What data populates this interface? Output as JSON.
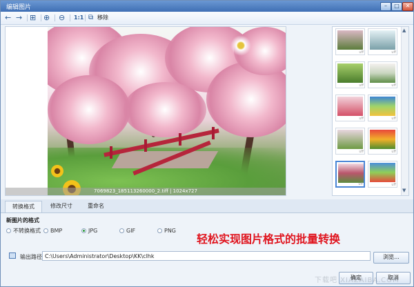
{
  "window": {
    "title": "编辑图片",
    "min_glyph": "–",
    "max_glyph": "□",
    "close_glyph": "✕"
  },
  "toolbar": {
    "back_glyph": "←",
    "forward_glyph": "→",
    "fit_glyph": "⊞",
    "zoom_in_glyph": "⊕",
    "zoom_out_glyph": "⊖",
    "actual_size_glyph": "1:1",
    "move_glyph": "⧉",
    "move_label": "移除"
  },
  "preview": {
    "filename": "7069823_185113260000_2.tiff | 1024x727"
  },
  "thumb_caption": "uff",
  "tabs": [
    {
      "label": "转换格式"
    },
    {
      "label": "修改尺寸"
    },
    {
      "label": "重命名"
    }
  ],
  "format": {
    "section_title": "新图片的格式",
    "options": [
      {
        "label": "不转换格式"
      },
      {
        "label": "BMP"
      },
      {
        "label": "JPG"
      },
      {
        "label": "GIF"
      },
      {
        "label": "PNG"
      }
    ],
    "selected": "JPG"
  },
  "banner": "轻松实现图片格式的批量转换",
  "output": {
    "label": "输出路径",
    "path": "C:\\Users\\Administrator\\Desktop\\KK\\clhk",
    "browse_label": "浏览..."
  },
  "buttons": {
    "ok_label": "确定",
    "cancel_label": "取消"
  },
  "watermark": "下载吧 XIAZAIBA.COM",
  "colors": {
    "accent": "#3f6fb4",
    "banner_red": "#e0141e",
    "selected_radio": "#2d9b3e"
  }
}
